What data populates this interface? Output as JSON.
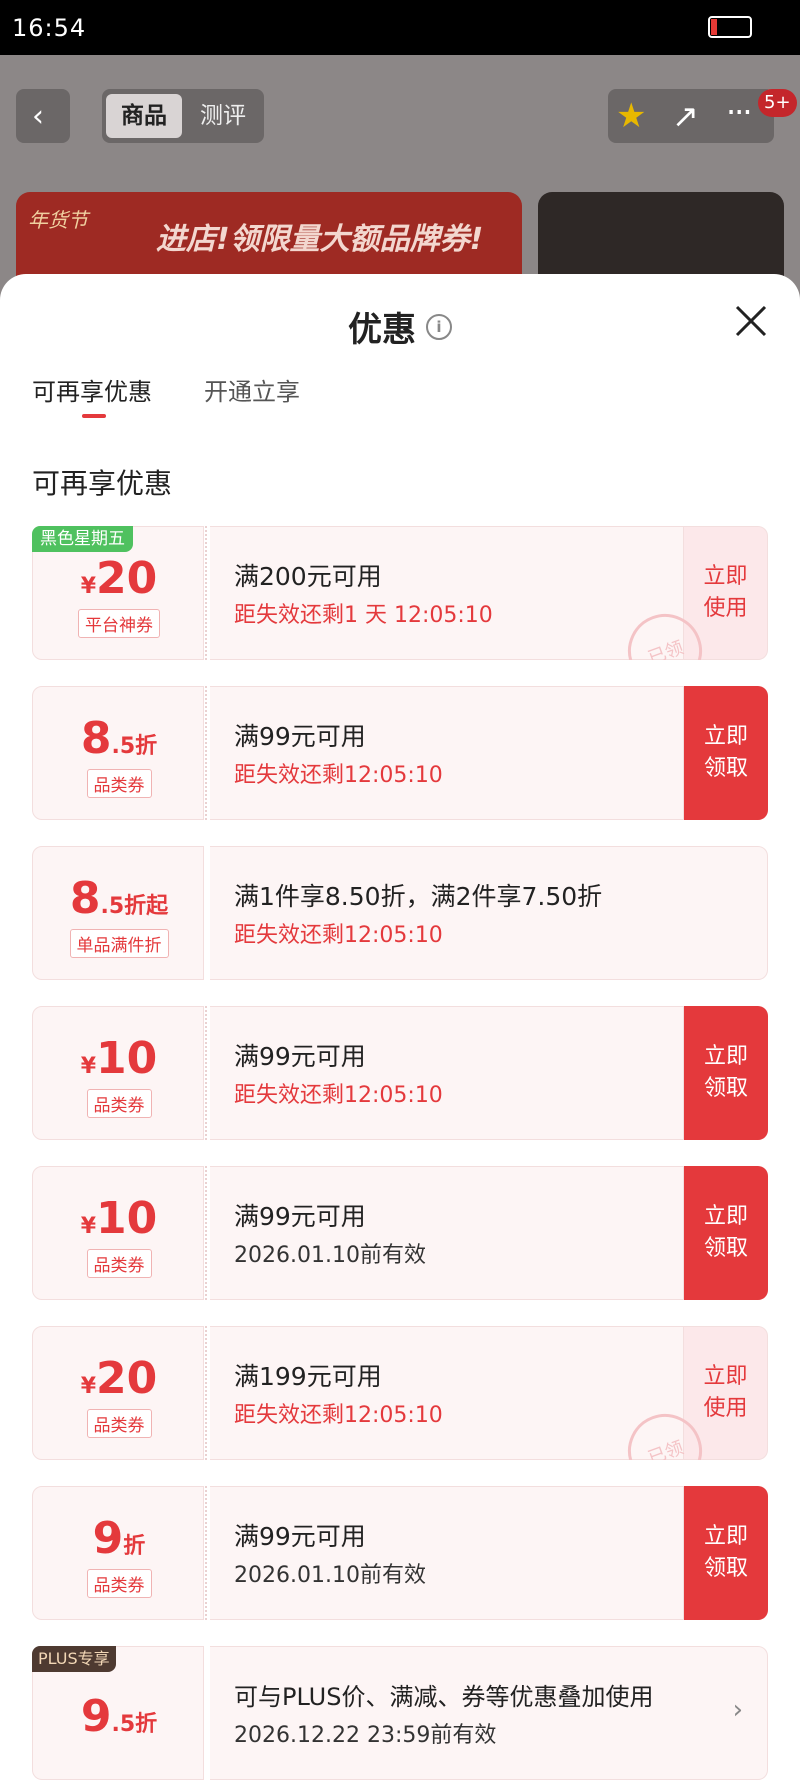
{
  "status_bar": {
    "time": "16:54"
  },
  "background_page": {
    "tabs": [
      "商品",
      "测评"
    ],
    "badge": "5+",
    "banner_text": "进店!领限量大额品牌券!",
    "banner_logo": "年货节"
  },
  "sheet": {
    "title": "优惠",
    "info_icon": "ⓘ",
    "tabs": [
      "可再享优惠",
      "开通立享"
    ],
    "section_title": "可再享优惠"
  },
  "coupons": [
    {
      "tag": "黑色星期五",
      "currency": "¥",
      "value": "20",
      "unit": "",
      "type": "平台神券",
      "condition": "满200元可用",
      "subtext": "距失效还剩1 天 12:05:10",
      "button": [
        "立即",
        "使用"
      ],
      "stamp": "已领"
    },
    {
      "currency": "",
      "value": "8",
      "unit": ".5折",
      "type": "品类券",
      "condition": "满99元可用",
      "subtext": "距失效还剩12:05:10",
      "button": [
        "立即",
        "领取"
      ]
    },
    {
      "currency": "",
      "value": "8",
      "unit": ".5折起",
      "type": "单品满件折",
      "condition": "满1件享8.50折，满2件享7.50折",
      "subtext": "距失效还剩12:05:10"
    },
    {
      "currency": "¥",
      "value": "10",
      "unit": "",
      "type": "品类券",
      "condition": "满99元可用",
      "subtext": "距失效还剩12:05:10",
      "button": [
        "立即",
        "领取"
      ]
    },
    {
      "currency": "¥",
      "value": "10",
      "unit": "",
      "type": "品类券",
      "condition": "满99元可用",
      "subtext": "2026.01.10前有效",
      "button": [
        "立即",
        "领取"
      ]
    },
    {
      "currency": "¥",
      "value": "20",
      "unit": "",
      "type": "品类券",
      "condition": "满199元可用",
      "subtext": "距失效还剩12:05:10",
      "button": [
        "立即",
        "使用"
      ],
      "stamp": "已领"
    },
    {
      "currency": "",
      "value": "9",
      "unit": "折",
      "type": "品类券",
      "condition": "满99元可用",
      "subtext": "2026.01.10前有效",
      "button": [
        "立即",
        "领取"
      ]
    },
    {
      "tag": "PLUS专享",
      "currency": "",
      "value": "9",
      "unit": ".5折",
      "condition": "可与PLUS价、满减、券等优惠叠加使用",
      "subtext": "2026.12.22 23:59前有效",
      "chevron": "›"
    }
  ]
}
